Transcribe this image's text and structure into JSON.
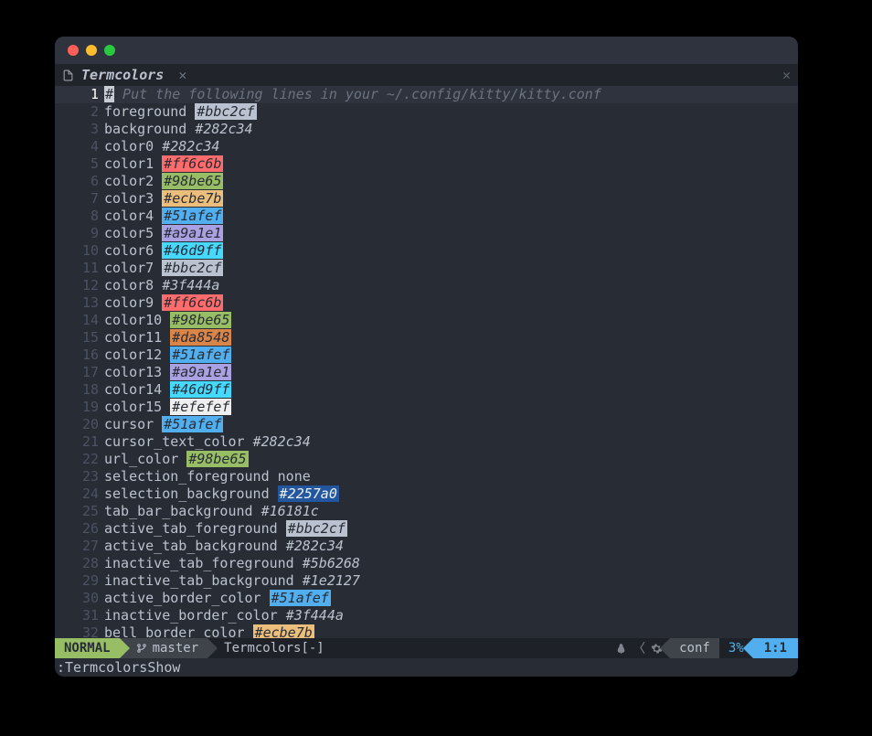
{
  "tab": {
    "title": "Termcolors"
  },
  "comment": {
    "hash": "#",
    "text": " Put the following lines in your ~/.config/kitty/kitty.conf"
  },
  "lines": [
    {
      "n": 1,
      "type": "comment"
    },
    {
      "n": 2,
      "key": "foreground",
      "val": "#bbc2cf",
      "bg": "#bbc2cf",
      "fg": "#282c34"
    },
    {
      "n": 3,
      "key": "background",
      "val": "#282c34",
      "plain": true
    },
    {
      "n": 4,
      "key": "color0",
      "val": "#282c34",
      "plain": true
    },
    {
      "n": 5,
      "key": "color1",
      "val": "#ff6c6b",
      "bg": "#ff6c6b",
      "fg": "#282c34"
    },
    {
      "n": 6,
      "key": "color2",
      "val": "#98be65",
      "bg": "#98be65",
      "fg": "#282c34"
    },
    {
      "n": 7,
      "key": "color3",
      "val": "#ecbe7b",
      "bg": "#ecbe7b",
      "fg": "#282c34"
    },
    {
      "n": 8,
      "key": "color4",
      "val": "#51afef",
      "bg": "#51afef",
      "fg": "#282c34"
    },
    {
      "n": 9,
      "key": "color5",
      "val": "#a9a1e1",
      "bg": "#a9a1e1",
      "fg": "#282c34"
    },
    {
      "n": 10,
      "key": "color6",
      "val": "#46d9ff",
      "bg": "#46d9ff",
      "fg": "#282c34"
    },
    {
      "n": 11,
      "key": "color7",
      "val": "#bbc2cf",
      "bg": "#bbc2cf",
      "fg": "#282c34"
    },
    {
      "n": 12,
      "key": "color8",
      "val": "#3f444a",
      "plain": true
    },
    {
      "n": 13,
      "key": "color9",
      "val": "#ff6c6b",
      "bg": "#ff6c6b",
      "fg": "#282c34"
    },
    {
      "n": 14,
      "key": "color10",
      "val": "#98be65",
      "bg": "#98be65",
      "fg": "#282c34"
    },
    {
      "n": 15,
      "key": "color11",
      "val": "#da8548",
      "bg": "#da8548",
      "fg": "#282c34"
    },
    {
      "n": 16,
      "key": "color12",
      "val": "#51afef",
      "bg": "#51afef",
      "fg": "#282c34"
    },
    {
      "n": 17,
      "key": "color13",
      "val": "#a9a1e1",
      "bg": "#a9a1e1",
      "fg": "#282c34"
    },
    {
      "n": 18,
      "key": "color14",
      "val": "#46d9ff",
      "bg": "#46d9ff",
      "fg": "#282c34"
    },
    {
      "n": 19,
      "key": "color15",
      "val": "#efefef",
      "bg": "#efefef",
      "fg": "#282c34"
    },
    {
      "n": 20,
      "key": "cursor",
      "val": "#51afef",
      "bg": "#51afef",
      "fg": "#282c34"
    },
    {
      "n": 21,
      "key": "cursor_text_color",
      "val": "#282c34",
      "plain": true
    },
    {
      "n": 22,
      "key": "url_color",
      "val": "#98be65",
      "bg": "#98be65",
      "fg": "#282c34"
    },
    {
      "n": 23,
      "key": "selection_foreground",
      "val": "none",
      "none": true
    },
    {
      "n": 24,
      "key": "selection_background",
      "val": "#2257a0",
      "bg": "#2257a0",
      "fg": "#efefef"
    },
    {
      "n": 25,
      "key": "tab_bar_background",
      "val": "#16181c",
      "plain": true
    },
    {
      "n": 26,
      "key": "active_tab_foreground",
      "val": "#bbc2cf",
      "bg": "#bbc2cf",
      "fg": "#282c34"
    },
    {
      "n": 27,
      "key": "active_tab_background",
      "val": "#282c34",
      "plain": true
    },
    {
      "n": 28,
      "key": "inactive_tab_foreground",
      "val": "#5b6268",
      "plain": true
    },
    {
      "n": 29,
      "key": "inactive_tab_background",
      "val": "#1e2127",
      "plain": true
    },
    {
      "n": 30,
      "key": "active_border_color",
      "val": "#51afef",
      "bg": "#51afef",
      "fg": "#282c34"
    },
    {
      "n": 31,
      "key": "inactive_border_color",
      "val": "#3f444a",
      "plain": true
    },
    {
      "n": 32,
      "key": "bell_border_color",
      "val": "#ecbe7b",
      "bg": "#ecbe7b",
      "fg": "#282c34"
    }
  ],
  "status": {
    "mode": "NORMAL",
    "branch": "master",
    "filename": "Termcolors",
    "modified": "[-]",
    "filetype": "conf",
    "percent": "3%",
    "position": "1:1"
  },
  "cmdline": ":TermcolorsShow"
}
